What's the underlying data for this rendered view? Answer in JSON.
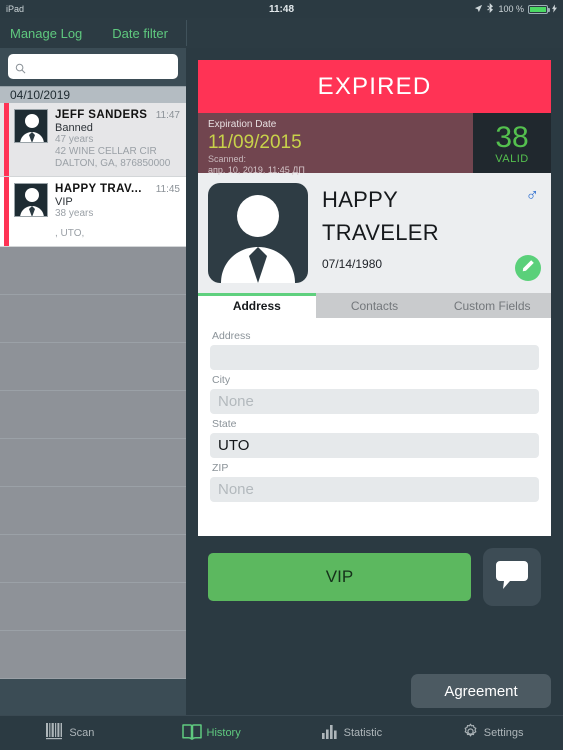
{
  "statusbar": {
    "device": "iPad",
    "time": "11:48",
    "battery_percent": "100 %",
    "location_icon": "location-arrow-icon",
    "bluetooth_icon": "bluetooth-icon",
    "charging_icon": "charging-bolt-icon"
  },
  "topnav": {
    "manage_log": "Manage Log",
    "date_filter": "Date filter"
  },
  "sidebar": {
    "search": {
      "value": "",
      "placeholder": ""
    },
    "date_header": "04/10/2019",
    "entries": [
      {
        "name": "JEFF  SANDERS",
        "time": "11:47",
        "status": "Banned",
        "age": "47 years",
        "address_line1": "42 WINE CELLAR CIR",
        "address_line2": "DALTON, GA, 876850000",
        "selected": true,
        "accent": "#ff3355"
      },
      {
        "name": "HAPPY  TRAV...",
        "time": "11:45",
        "status": "VIP",
        "age": "38 years",
        "address_line1": "",
        "address_line2": ", UTO,",
        "selected": false,
        "accent": "#ff3355"
      }
    ]
  },
  "detail": {
    "banner": {
      "text": "EXPIRED",
      "color": "#ff3355"
    },
    "expiration": {
      "label": "Expiration Date",
      "date": "11/09/2015",
      "scanned_label": "Scanned:",
      "scanned_value": "апр. 10, 2019, 11:45 ДП"
    },
    "age_badge": {
      "value": "38",
      "label": "VALID",
      "color": "#54c04e"
    },
    "person": {
      "first_name": "HAPPY",
      "last_name": "TRAVELER",
      "dob": "07/14/1980",
      "sex_icon": "male-symbol-icon",
      "edit_icon": "pencil-icon"
    },
    "tabs": [
      {
        "label": "Address",
        "active": true
      },
      {
        "label": "Contacts",
        "active": false
      },
      {
        "label": "Custom Fields",
        "active": false
      }
    ],
    "fields": [
      {
        "label": "Address",
        "value": "",
        "placeholder": ""
      },
      {
        "label": "City",
        "value": "",
        "placeholder": "None"
      },
      {
        "label": "State",
        "value": "UTO",
        "placeholder": ""
      },
      {
        "label": "ZIP",
        "value": "",
        "placeholder": "None"
      }
    ],
    "actions": {
      "vip_label": "VIP",
      "message_icon": "speech-bubble-icon",
      "agreement_label": "Agreement"
    }
  },
  "tabbar": [
    {
      "label": "Scan",
      "icon": "barcode-icon",
      "active": false
    },
    {
      "label": "History",
      "icon": "open-book-icon",
      "active": true
    },
    {
      "label": "Statistic",
      "icon": "bar-chart-icon",
      "active": false
    },
    {
      "label": "Settings",
      "icon": "gear-icon",
      "active": false
    }
  ]
}
